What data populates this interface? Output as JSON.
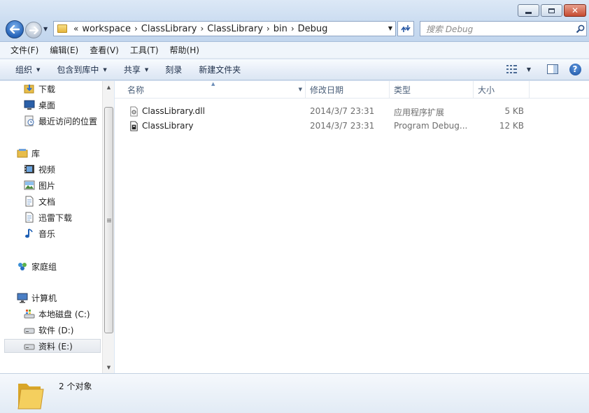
{
  "window": {
    "controls": {
      "minimize": "minimize",
      "maximize": "maximize",
      "close": "close"
    }
  },
  "address": {
    "prefix": "«",
    "crumbs": [
      "workspace",
      "ClassLibrary",
      "ClassLibrary",
      "bin",
      "Debug"
    ],
    "separator": "›"
  },
  "search": {
    "placeholder": "搜索 Debug"
  },
  "menu": [
    "文件(F)",
    "编辑(E)",
    "查看(V)",
    "工具(T)",
    "帮助(H)"
  ],
  "toolbar": {
    "organize": "组织",
    "include_in_library": "包含到库中",
    "share": "共享",
    "burn": "刻录",
    "new_folder": "新建文件夹",
    "help": "?"
  },
  "nav": {
    "favorites": [
      {
        "label": "下载",
        "icon": "download-folder-icon"
      },
      {
        "label": "桌面",
        "icon": "desktop-icon"
      },
      {
        "label": "最近访问的位置",
        "icon": "recent-places-icon"
      }
    ],
    "libraries": {
      "label": "库",
      "icon": "library-icon"
    },
    "library_items": [
      {
        "label": "视频",
        "icon": "video-icon"
      },
      {
        "label": "图片",
        "icon": "picture-icon"
      },
      {
        "label": "文档",
        "icon": "document-icon"
      },
      {
        "label": "迅雷下载",
        "icon": "document-icon"
      },
      {
        "label": "音乐",
        "icon": "music-icon"
      }
    ],
    "homegroup": {
      "label": "家庭组",
      "icon": "homegroup-icon"
    },
    "computer": {
      "label": "计算机",
      "icon": "computer-icon"
    },
    "drives": [
      {
        "label": "本地磁盘 (C:)",
        "icon": "windows-drive-icon",
        "selected": false
      },
      {
        "label": "软件 (D:)",
        "icon": "drive-icon",
        "selected": false
      },
      {
        "label": "资料 (E:)",
        "icon": "drive-icon",
        "selected": true
      }
    ]
  },
  "columns": {
    "name": "名称",
    "date": "修改日期",
    "type": "类型",
    "size": "大小"
  },
  "files": [
    {
      "name": "ClassLibrary.dll",
      "date": "2014/3/7 23:31",
      "type": "应用程序扩展",
      "size": "5 KB",
      "icon": "dll-file-icon"
    },
    {
      "name": "ClassLibrary",
      "date": "2014/3/7 23:31",
      "type": "Program Debug...",
      "size": "12 KB",
      "icon": "pdb-file-icon"
    }
  ],
  "status": {
    "count": "2 个对象"
  },
  "colors": {
    "accent": "#2563b8",
    "title_bg": "#c9dbf0",
    "toolbar_bg": "#e7eef8"
  }
}
